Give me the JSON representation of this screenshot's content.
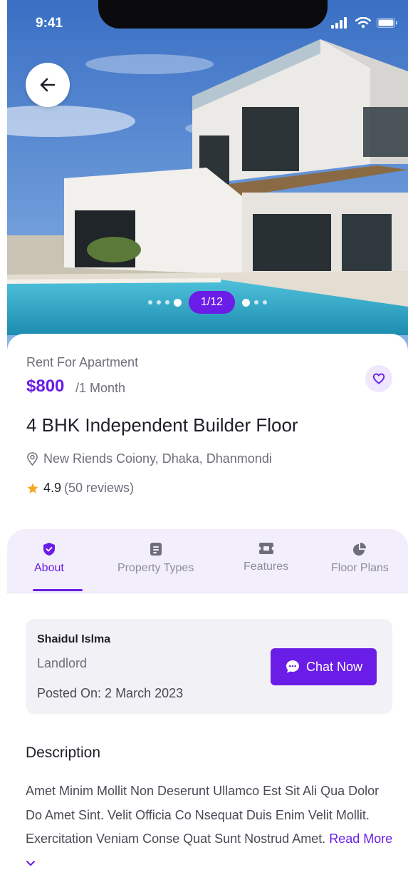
{
  "status_bar": {
    "time": "9:41"
  },
  "gallery": {
    "current": 1,
    "total": 12,
    "counter_text": "1/12"
  },
  "property": {
    "listing_type": "Rent For Apartment",
    "price": "$800",
    "price_period": "/1 Month",
    "title": "4 BHK Independent Builder Floor",
    "location": "New Riends Coiony, Dhaka, Dhanmondi",
    "rating": "4.9",
    "reviews": "(50 reviews)"
  },
  "tabs": [
    {
      "label": "About",
      "icon": "shield-icon",
      "active": true
    },
    {
      "label": "Property Types",
      "icon": "document-icon",
      "active": false
    },
    {
      "label": "Features",
      "icon": "ticket-icon",
      "active": false
    },
    {
      "label": "Floor Plans",
      "icon": "pie-chart-icon",
      "active": false
    }
  ],
  "owner": {
    "name": "Shaidul Islma",
    "role": "Landlord",
    "posted": "Posted On: 2 March 2023",
    "chat_label": "Chat Now"
  },
  "description": {
    "title": "Description",
    "text": "Amet Minim Mollit Non Deserunt Ullamco Est Sit Ali Qua Dolor Do Amet Sint. Velit Officia Co Nsequat Duis Enim Velit Mollit. Exercitation Veniam Conse Quat Sunt Nostrud Amet.",
    "read_more": "Read More"
  },
  "colors": {
    "accent": "#6a1de6",
    "accent_light": "#efe7fd",
    "star": "#f5a623"
  }
}
